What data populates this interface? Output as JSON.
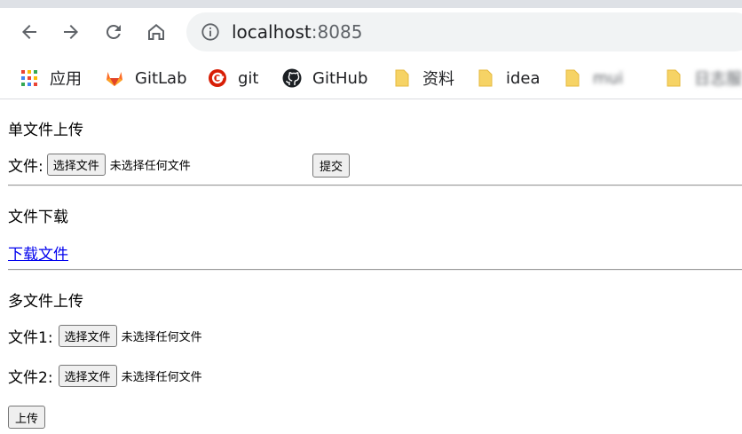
{
  "browser": {
    "url_host": "localhost",
    "url_port": ":8085",
    "nav_icons": [
      "back-arrow-icon",
      "forward-arrow-icon",
      "reload-icon",
      "home-icon",
      "info-icon"
    ]
  },
  "bookmarks": [
    {
      "label": "应用",
      "icon": "apps-grid-icon"
    },
    {
      "label": "GitLab",
      "icon": "gitlab-fox-icon",
      "color": "#e24329"
    },
    {
      "label": "git",
      "icon": "git-logo-icon",
      "color": "#d81e06"
    },
    {
      "label": "GitHub",
      "icon": "github-octocat-icon",
      "color": "#1b1f23"
    },
    {
      "label": "资料",
      "icon": "folder-icon",
      "color": "#f6d365"
    },
    {
      "label": "idea",
      "icon": "folder-icon",
      "color": "#f6d365"
    },
    {
      "label": "mui",
      "icon": "folder-icon",
      "color": "#f6d365"
    },
    {
      "label": "日志服",
      "icon": "folder-icon",
      "color": "#f6d365"
    }
  ],
  "single_upload": {
    "title": "单文件上传",
    "file_label": "文件:",
    "choose_button": "选择文件",
    "status": "未选择任何文件",
    "submit_button": "提交"
  },
  "download": {
    "title": "文件下载",
    "link_text": "下载文件"
  },
  "multi_upload": {
    "title": "多文件上传",
    "file1_label": "文件1:",
    "file2_label": "文件2:",
    "choose_button": "选择文件",
    "status": "未选择任何文件",
    "upload_button": "上传"
  }
}
